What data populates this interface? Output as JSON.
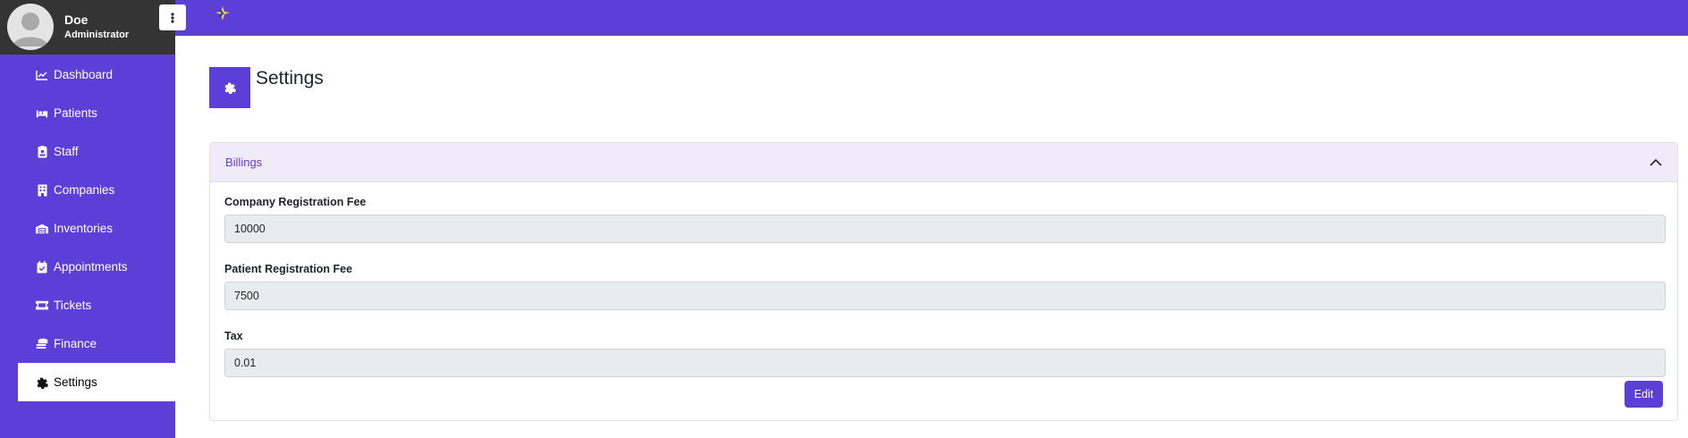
{
  "user": {
    "name": "Doe",
    "role": "Administrator"
  },
  "sidebar": {
    "items": [
      {
        "label": "Dashboard",
        "icon": "chart-line-icon"
      },
      {
        "label": "Patients",
        "icon": "bed-icon"
      },
      {
        "label": "Staff",
        "icon": "id-badge-icon"
      },
      {
        "label": "Companies",
        "icon": "building-icon"
      },
      {
        "label": "Inventories",
        "icon": "warehouse-icon"
      },
      {
        "label": "Appointments",
        "icon": "calendar-check-icon"
      },
      {
        "label": "Tickets",
        "icon": "ticket-icon"
      },
      {
        "label": "Finance",
        "icon": "coins-icon"
      },
      {
        "label": "Settings",
        "icon": "gear-icon",
        "active": true
      }
    ]
  },
  "page": {
    "title": "Settings"
  },
  "billings": {
    "header": "Billings",
    "fields": [
      {
        "label": "Company Registration Fee",
        "value": "10000"
      },
      {
        "label": "Patient Registration Fee",
        "value": "7500"
      },
      {
        "label": "Tax",
        "value": "0.01"
      }
    ],
    "edit_label": "Edit"
  },
  "colors": {
    "accent": "#5c3fd6",
    "user_box": "#343434",
    "header_bg": "#efebf9",
    "input_bg": "#e9ecef"
  }
}
